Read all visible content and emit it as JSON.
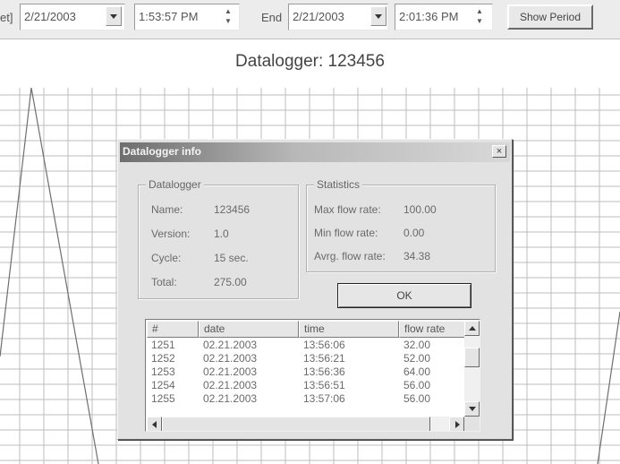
{
  "toolbar": {
    "start_label_fragment": "et]",
    "start_date": "2/21/2003",
    "start_time": "1:53:57 PM",
    "end_label": "End",
    "end_date": "2/21/2003",
    "end_time": "2:01:36 PM",
    "show_period_label": "Show Period",
    "spin_up": "▲",
    "spin_down": "▼"
  },
  "chart": {
    "title": "Datalogger: 123456",
    "grid": true,
    "colors": {
      "grid": "#bdbdbd",
      "line": "#6e6e6e"
    }
  },
  "dialog": {
    "title": "Datalogger info",
    "close_label": "×",
    "datalogger_group": {
      "legend": "Datalogger",
      "fields": [
        {
          "label": "Name:",
          "value": "123456"
        },
        {
          "label": "Version:",
          "value": "1.0"
        },
        {
          "label": "Cycle:",
          "value": "15 sec."
        },
        {
          "label": "Total:",
          "value": "275.00"
        }
      ]
    },
    "statistics_group": {
      "legend": "Statistics",
      "fields": [
        {
          "label": "Max flow rate:",
          "value": "100.00"
        },
        {
          "label": "Min flow rate:",
          "value": "0.00"
        },
        {
          "label": "Avrg. flow rate:",
          "value": "34.38"
        }
      ]
    },
    "ok_label": "OK",
    "list": {
      "columns": [
        "#",
        "date",
        "time",
        "flow rate"
      ],
      "rows": [
        [
          "1251",
          "02.21.2003",
          "13:56:06",
          "32.00"
        ],
        [
          "1252",
          "02.21.2003",
          "13:56:21",
          "52.00"
        ],
        [
          "1253",
          "02.21.2003",
          "13:56:36",
          "64.00"
        ],
        [
          "1254",
          "02.21.2003",
          "13:56:51",
          "56.00"
        ],
        [
          "1255",
          "02.21.2003",
          "13:57:06",
          "56.00"
        ]
      ]
    }
  }
}
